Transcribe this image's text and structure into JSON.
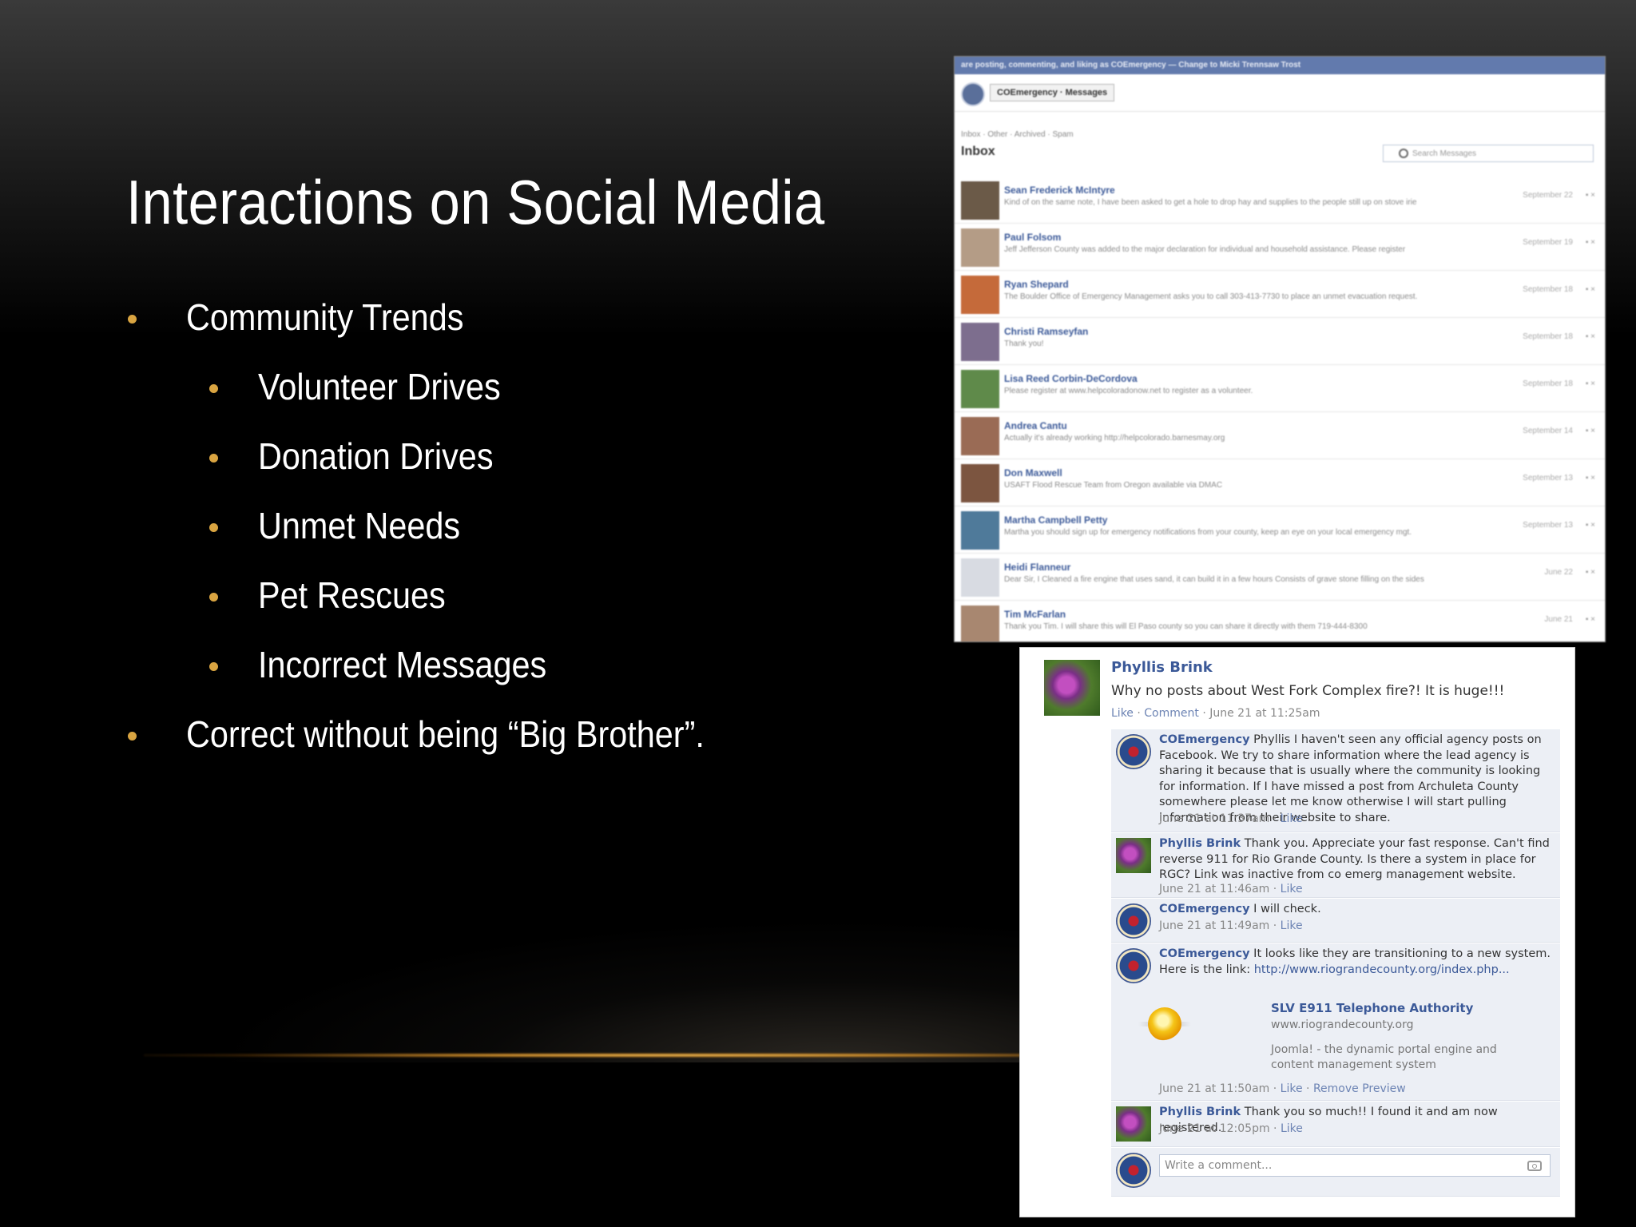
{
  "slide": {
    "title": "Interactions on Social Media",
    "bullets": [
      {
        "level": 1,
        "text": "Community Trends"
      },
      {
        "level": 2,
        "text": "Volunteer Drives"
      },
      {
        "level": 2,
        "text": "Donation Drives"
      },
      {
        "level": 2,
        "text": "Unmet Needs"
      },
      {
        "level": 2,
        "text": "Pet Rescues"
      },
      {
        "level": 2,
        "text": "Incorrect Messages"
      },
      {
        "level": 1,
        "text": "Correct without being “Big Brother”."
      }
    ],
    "accent_color": "#d9a441"
  },
  "inbox": {
    "top_bar": "are posting, commenting, and liking as COEmergency — Change to Micki Trennsaw Trost",
    "account_menu": "COEmergency · Messages",
    "breadcrumb": "Inbox · Other · Archived · Spam",
    "heading": "Inbox",
    "search_placeholder": "Search Messages",
    "messages": [
      {
        "name": "Sean Frederick McIntyre",
        "preview": "Kind of on the same note, I have been asked to get a hole to drop hay and supplies to the people still up on stove irie",
        "date": "September 22"
      },
      {
        "name": "Paul Folsom",
        "preview": "Jeff Jefferson County was added to the major declaration for individual and household assistance. Please register",
        "date": "September 19"
      },
      {
        "name": "Ryan Shepard",
        "preview": "The Boulder Office of Emergency Management asks you to call 303-413-7730 to place an unmet evacuation request.",
        "date": "September 18"
      },
      {
        "name": "Christi Ramseyfan",
        "preview": "Thank you!",
        "date": "September 18"
      },
      {
        "name": "Lisa Reed Corbin-DeCordova",
        "preview": "Please register at www.helpcoloradonow.net to register as a volunteer.",
        "date": "September 18"
      },
      {
        "name": "Andrea Cantu",
        "preview": "Actually it's already working http://helpcolorado.barnesmay.org",
        "date": "September 14"
      },
      {
        "name": "Don Maxwell",
        "preview": "USAFT Flood Rescue Team from Oregon available via DMAC",
        "date": "September 13"
      },
      {
        "name": "Martha Campbell Petty",
        "preview": "Martha you should sign up for emergency notifications from your county, keep an eye on your local emergency mgt.",
        "date": "September 13"
      },
      {
        "name": "Heidi Flanneur",
        "preview": "Dear Sir, I Cleaned a fire engine that uses sand, it can build it in a few hours Consists of grave stone filling on the sides",
        "date": "June 22"
      },
      {
        "name": "Tim McFarlan",
        "preview": "Thank you Tim. I will share this will El Paso county so you can share it directly with them 719-444-8300",
        "date": "June 21"
      }
    ]
  },
  "thread": {
    "post": {
      "author": "Phyllis Brink",
      "text": "Why no posts about West Fork Complex fire?! It is huge!!!",
      "like": "Like",
      "comment": "Comment",
      "time": "June 21 at 11:25am"
    },
    "comments": [
      {
        "author": "COEmergency",
        "text": "Phyllis I haven't seen any official agency posts on Facebook. We try to share information where the lead agency is sharing it because that is usually where the community is looking for information. If I have missed a post from Archuleta County somewhere please let me know otherwise I will start pulling information from their website to share.",
        "time": "June 21 at 11:37am",
        "like": "Like"
      },
      {
        "author": "Phyllis Brink",
        "text": "Thank you. Appreciate your fast response. Can't find reverse 911 for Rio Grande County. Is there a system in place for RGC? Link was inactive from co emerg management website.",
        "time": "June 21 at 11:46am",
        "like": "Like"
      },
      {
        "author": "COEmergency",
        "text": "I will check.",
        "time": "June 21 at 11:49am",
        "like": "Like"
      },
      {
        "author": "COEmergency",
        "text": "It looks like they are transitioning to a new system. Here is the link:",
        "link": "http://www.riograndecounty.org/index.php...",
        "time": "June 21 at 11:50am",
        "like": "Like",
        "remove_preview": "Remove Preview",
        "preview": {
          "title": "SLV E911 Telephone Authority",
          "url": "www.riograndecounty.org",
          "desc": "Joomla! - the dynamic portal engine and content management system"
        }
      },
      {
        "author": "Phyllis Brink",
        "text": "Thank you so much!! I found it and am now registered.",
        "time": "June 21 at 12:05pm",
        "like": "Like"
      }
    ],
    "write_placeholder": "Write a comment..."
  }
}
